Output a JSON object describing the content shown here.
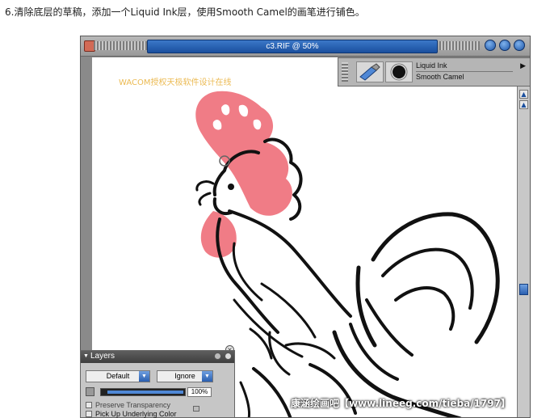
{
  "caption": "6.清除底层的草稿，添加一个Liquid Ink层，使用Smooth Camel的画笔进行铺色。",
  "window": {
    "title": "c3.RIF @ 50%"
  },
  "brush": {
    "category": "Liquid Ink",
    "variant": "Smooth Camel"
  },
  "watermark": "WACOM授权天极软件设计在线",
  "layers_panel": {
    "title": "Layers",
    "composite_method": "Default",
    "depth_mode": "Ignore",
    "opacity_label": "100%",
    "opacity_value": 1.0,
    "preserve_transparency": "Preserve Transparency",
    "pick_up_underlying": "Pick Up Underlying Color"
  },
  "site_watermark": "康涵绘画吧【www.lineeg.com/tieba/1797】",
  "colors": {
    "title_blue": "#2a62b4",
    "comb_pink": "#f07c86",
    "ink": "#111111"
  }
}
